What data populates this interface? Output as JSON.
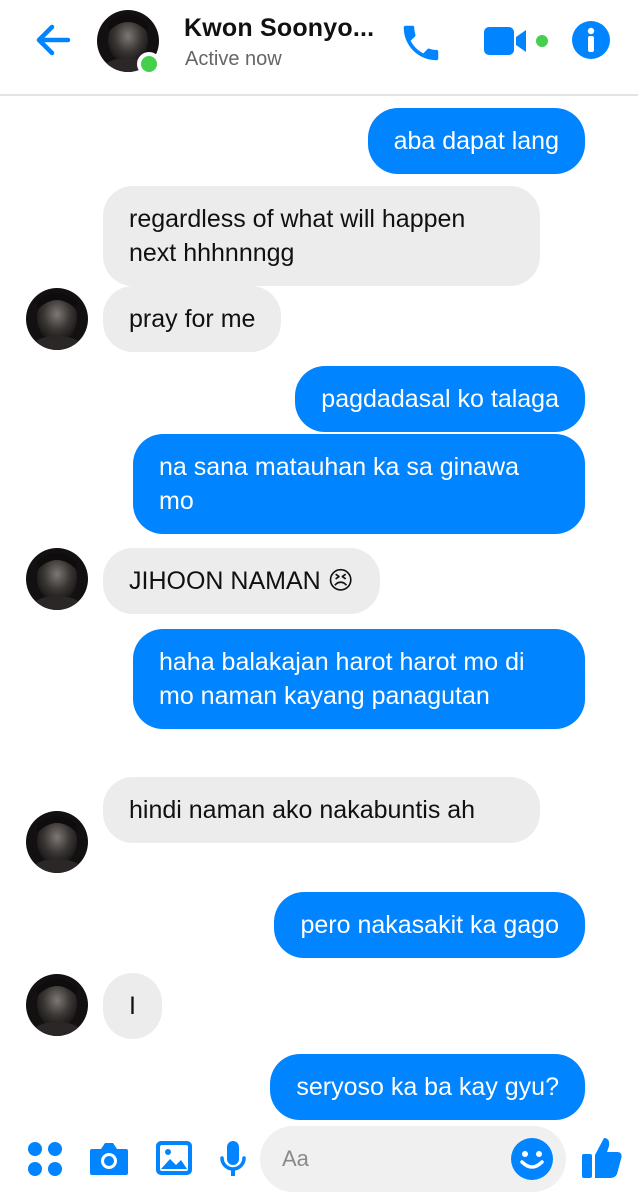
{
  "header": {
    "contact_name": "Kwon Soonyo...",
    "status": "Active now"
  },
  "messages": [
    {
      "direction": "outgoing",
      "text": "aba dapat lang"
    },
    {
      "direction": "incoming",
      "text": "regardless of what will happen next hhhnnngg"
    },
    {
      "direction": "incoming",
      "text": "pray for me"
    },
    {
      "direction": "outgoing",
      "text": "pagdadasal ko talaga"
    },
    {
      "direction": "outgoing",
      "text": "na sana matauhan ka sa ginawa mo"
    },
    {
      "direction": "incoming",
      "text": "JIHOON NAMAN",
      "emoji": "😣"
    },
    {
      "direction": "outgoing",
      "text": "haha balakajan harot harot mo di mo naman kayang panagutan"
    },
    {
      "direction": "incoming",
      "text": "hindi naman ako nakabuntis ah"
    },
    {
      "direction": "outgoing",
      "text": "pero nakasakit ka gago"
    },
    {
      "direction": "incoming",
      "text": "I"
    },
    {
      "direction": "outgoing",
      "text": "seryoso ka ba kay gyu?"
    }
  ],
  "composer": {
    "placeholder": "Aa"
  },
  "icons": {
    "back": "back-arrow-icon",
    "call": "phone-icon",
    "video": "video-camera-icon",
    "info": "info-icon",
    "more": "four-dots-icon",
    "camera": "camera-icon",
    "gallery": "image-icon",
    "mic": "microphone-icon",
    "emoji": "smiley-icon",
    "like": "thumbs-up-icon"
  },
  "colors": {
    "accent": "#0084ff",
    "incoming_bubble": "#ececec",
    "online": "#44d04c"
  }
}
